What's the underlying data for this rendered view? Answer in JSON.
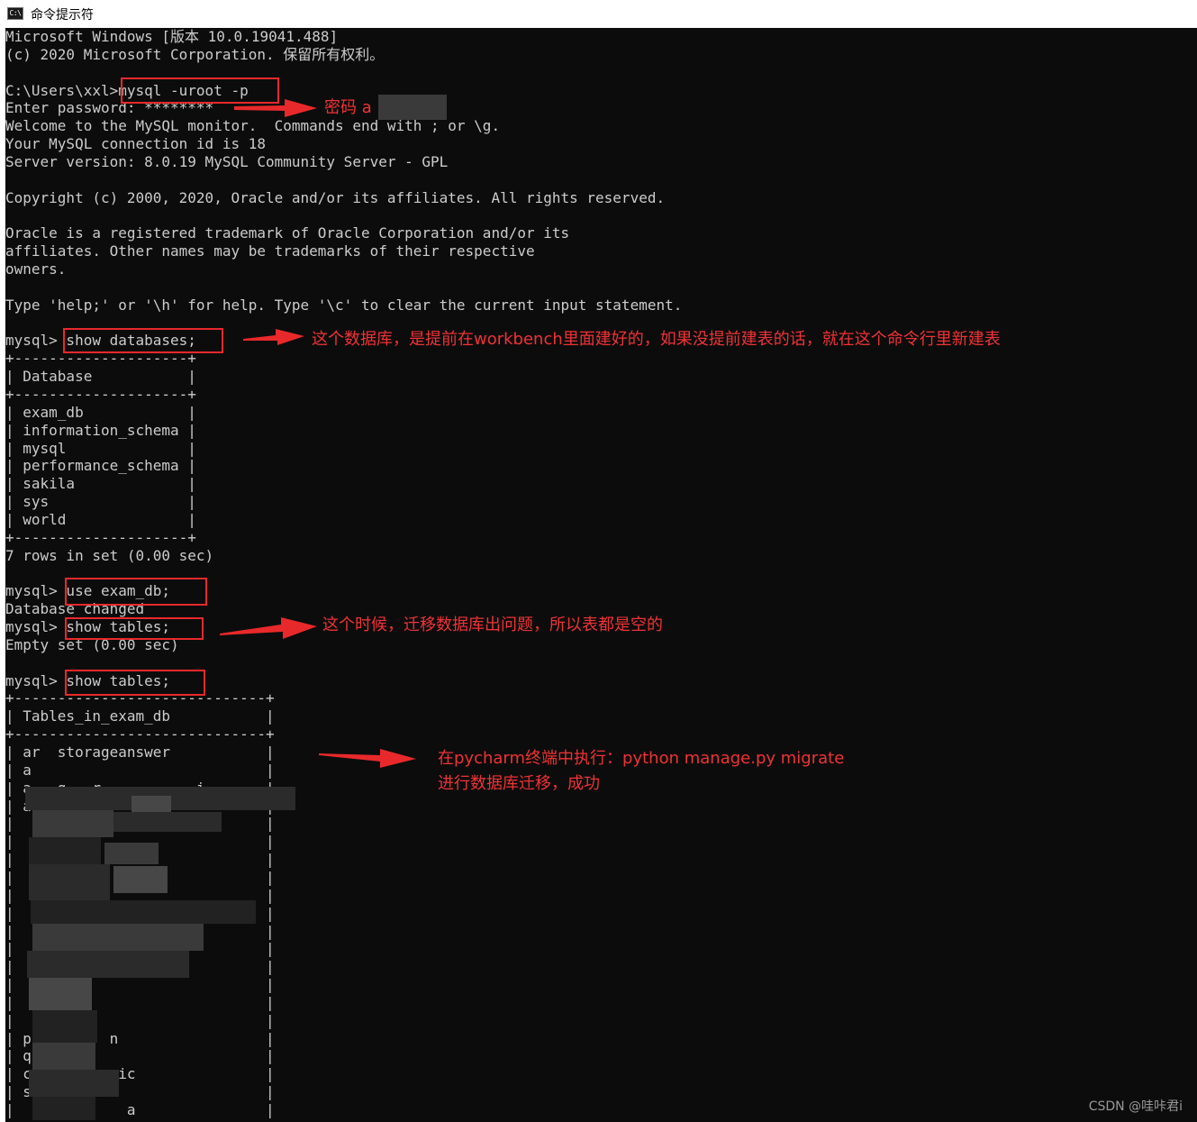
{
  "window": {
    "icon_label": "C:\\",
    "title": "命令提示符"
  },
  "console_lines": [
    "Microsoft Windows [版本 10.0.19041.488]",
    "(c) 2020 Microsoft Corporation. 保留所有权利。",
    "",
    "C:\\Users\\xxl>mysql -uroot -p",
    "Enter password: ********",
    "Welcome to the MySQL monitor.  Commands end with ; or \\g.",
    "Your MySQL connection id is 18",
    "Server version: 8.0.19 MySQL Community Server - GPL",
    "",
    "Copyright (c) 2000, 2020, Oracle and/or its affiliates. All rights reserved.",
    "",
    "Oracle is a registered trademark of Oracle Corporation and/or its",
    "affiliates. Other names may be trademarks of their respective",
    "owners.",
    "",
    "Type 'help;' or '\\h' for help. Type '\\c' to clear the current input statement.",
    "",
    "mysql> show databases;",
    "+--------------------+",
    "| Database           |",
    "+--------------------+",
    "| exam_db            |",
    "| information_schema |",
    "| mysql              |",
    "| performance_schema |",
    "| sakila             |",
    "| sys                |",
    "| world              |",
    "+--------------------+",
    "7 rows in set (0.00 sec)",
    "",
    "mysql> use exam_db;",
    "Database changed",
    "mysql> show tables;",
    "Empty set (0.00 sec)",
    "",
    "mysql> show tables;",
    "+-----------------------------+",
    "| Tables_in_exam_db           |",
    "+-----------------------------+",
    "| ar  storageanswer           |",
    "| a                           |",
    "| a   g   r           i       |",
    "| auth                        |",
    "|                             |",
    "|                             |",
    "|            el_              |",
    "|     p                       |",
    "|                             |",
    "|                             |",
    "|                             |",
    "|                             |",
    "|                             |",
    "|                             |",
    "|                             |",
    "|                             |",
    "| pa        n                 |",
    "| q                           |",
    "| c         pic               |",
    "| s                           |",
    "|             a               |",
    "|                             |",
    "+-----------------------------+"
  ],
  "annotations": {
    "password_note": "密码 a",
    "databases_note": "这个数据库，是提前在workbench里面建好的，如果没提前建表的话，就在这个命令行里新建表",
    "empty_note": "这个时候，迁移数据库出问题，所以表都是空的",
    "migrate_note_line1": "在pycharm终端中执行：python manage.py migrate",
    "migrate_note_line2": "进行数据库迁移，成功"
  },
  "watermark": "CSDN @哇咔君i",
  "colors": {
    "console_bg": "#0c0c0c",
    "console_text": "#cccccc",
    "annotation_red": "#e8292b"
  }
}
